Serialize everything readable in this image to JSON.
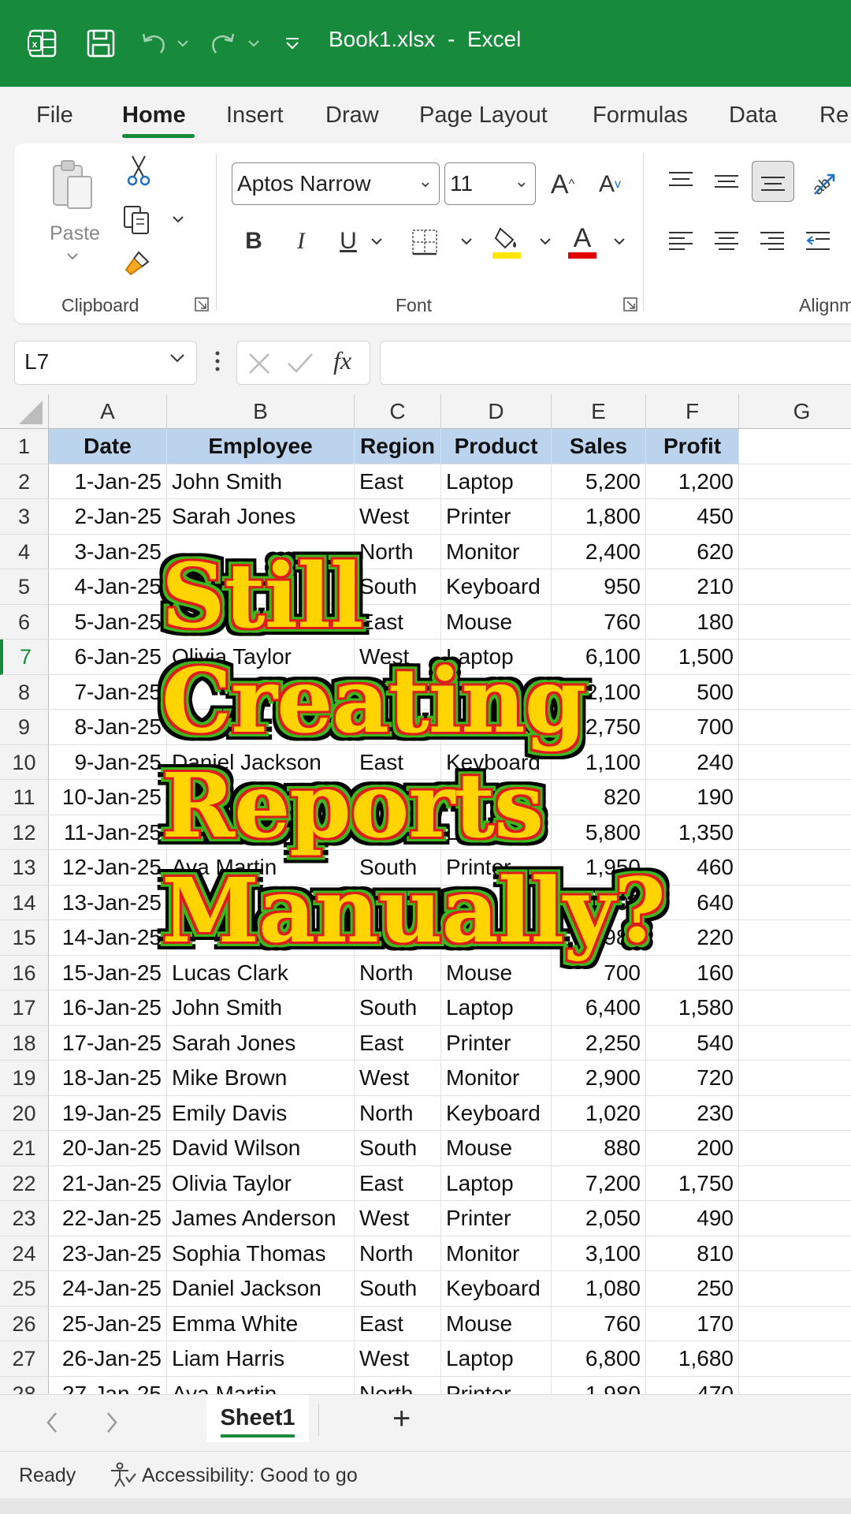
{
  "titlebar": {
    "title": "Book1.xlsx  -  Excel",
    "bg_color": "#188a3c"
  },
  "menu": {
    "tabs": [
      "File",
      "Home",
      "Insert",
      "Draw",
      "Page Layout",
      "Formulas",
      "Data",
      "Re"
    ],
    "active": "Home"
  },
  "ribbon": {
    "paste_label": "Paste",
    "font_name": "Aptos Narrow",
    "font_size": "11",
    "grow_font": "A",
    "shrink_font": "A",
    "bold": "B",
    "italic": "I",
    "underline": "U",
    "font_color_glyph": "A",
    "groups": {
      "clipboard": "Clipboard",
      "font": "Font",
      "alignment": "Alignm"
    }
  },
  "formula_bar": {
    "name_box": "L7",
    "fx": "fx",
    "formula": ""
  },
  "columns": [
    "A",
    "B",
    "C",
    "D",
    "E",
    "F",
    "G"
  ],
  "headers": [
    "Date",
    "Employee",
    "Region",
    "Product",
    "Sales",
    "Profit"
  ],
  "rows": [
    [
      "1-Jan-25",
      "John Smith",
      "East",
      "Laptop",
      "5,200",
      "1,200"
    ],
    [
      "2-Jan-25",
      "Sarah Jones",
      "West",
      "Printer",
      "1,800",
      "450"
    ],
    [
      "3-Jan-25",
      "",
      "North",
      "Monitor",
      "2,400",
      "620"
    ],
    [
      "4-Jan-25",
      "",
      "South",
      "Keyboard",
      "950",
      "210"
    ],
    [
      "5-Jan-25",
      "",
      "East",
      "Mouse",
      "760",
      "180"
    ],
    [
      "6-Jan-25",
      "Olivia Taylor",
      "West",
      "Laptop",
      "6,100",
      "1,500"
    ],
    [
      "7-Jan-25",
      "",
      "",
      "",
      "2,100",
      "500"
    ],
    [
      "8-Jan-25",
      "",
      "",
      "",
      "2,750",
      "700"
    ],
    [
      "9-Jan-25",
      "Daniel Jackson",
      "East",
      "Keyboard",
      "1,100",
      "240"
    ],
    [
      "10-Jan-25",
      "",
      "",
      "Mouse",
      "820",
      "190"
    ],
    [
      "11-Jan-25",
      "",
      "",
      "Laptop",
      "5,800",
      "1,350"
    ],
    [
      "12-Jan-25",
      "Ava Martin",
      "South",
      "Printer",
      "1,950",
      "460"
    ],
    [
      "13-Jan-25",
      "",
      "",
      "",
      "2,600",
      "640"
    ],
    [
      "14-Jan-25",
      "",
      "",
      "",
      "980",
      "220"
    ],
    [
      "15-Jan-25",
      "Lucas Clark",
      "North",
      "Mouse",
      "700",
      "160"
    ],
    [
      "16-Jan-25",
      "John Smith",
      "South",
      "Laptop",
      "6,400",
      "1,580"
    ],
    [
      "17-Jan-25",
      "Sarah Jones",
      "East",
      "Printer",
      "2,250",
      "540"
    ],
    [
      "18-Jan-25",
      "Mike Brown",
      "West",
      "Monitor",
      "2,900",
      "720"
    ],
    [
      "19-Jan-25",
      "Emily Davis",
      "North",
      "Keyboard",
      "1,020",
      "230"
    ],
    [
      "20-Jan-25",
      "David Wilson",
      "South",
      "Mouse",
      "880",
      "200"
    ],
    [
      "21-Jan-25",
      "Olivia Taylor",
      "East",
      "Laptop",
      "7,200",
      "1,750"
    ],
    [
      "22-Jan-25",
      "James Anderson",
      "West",
      "Printer",
      "2,050",
      "490"
    ],
    [
      "23-Jan-25",
      "Sophia Thomas",
      "North",
      "Monitor",
      "3,100",
      "810"
    ],
    [
      "24-Jan-25",
      "Daniel Jackson",
      "South",
      "Keyboard",
      "1,080",
      "250"
    ],
    [
      "25-Jan-25",
      "Emma White",
      "East",
      "Mouse",
      "760",
      "170"
    ],
    [
      "26-Jan-25",
      "Liam Harris",
      "West",
      "Laptop",
      "6,800",
      "1,680"
    ],
    [
      "27-Jan-25",
      "Ava Martin",
      "North",
      "Printer",
      "1,980",
      "470"
    ]
  ],
  "selected_row": 7,
  "overlay": {
    "lines": [
      "Still",
      "Creating",
      "Reports",
      "Manually?"
    ]
  },
  "sheets": {
    "active": "Sheet1",
    "add": "+"
  },
  "status": {
    "ready": "Ready",
    "accessibility": "Accessibility: Good to go"
  }
}
